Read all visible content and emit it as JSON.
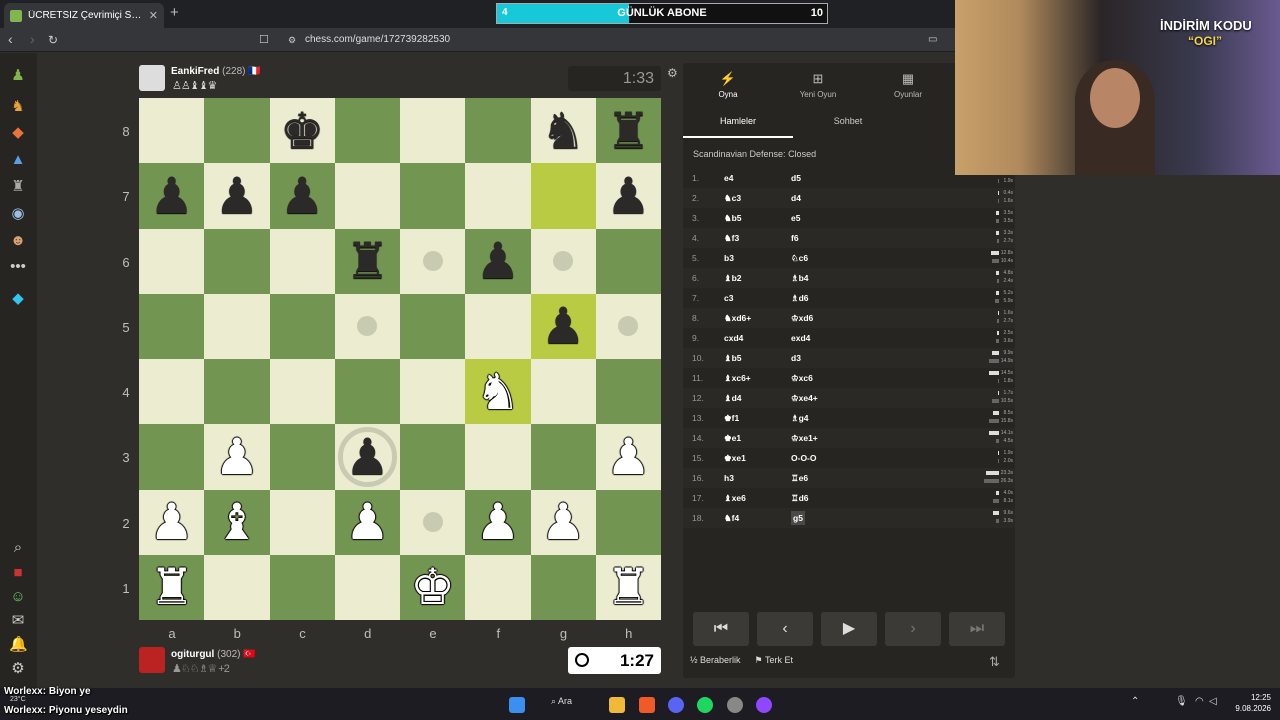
{
  "browser": {
    "tab_title": "ÜCRETSİZ Çevrimiçi Satranç Oyna",
    "new_tab": "+",
    "url": "chess.com/game/172739282530"
  },
  "sub_goal": {
    "current": "4",
    "label": "GÜNLÜK ABONE",
    "target": "10",
    "progress": 0.4
  },
  "promo": {
    "line1": "İNDİRİM KODU",
    "line2": "“OGI”"
  },
  "opponent": {
    "name": "EankiFred",
    "rating": "(228)",
    "flag": "🇫🇷",
    "captured": "♙♙♝♝♛",
    "clock": "1:33"
  },
  "player": {
    "name": "ogiturgul",
    "rating": "(302)",
    "flag": "🇹🇷",
    "captured": "♟♘♘♗♕",
    "extra": "+2",
    "clock": "1:27"
  },
  "board": {
    "files": [
      "a",
      "b",
      "c",
      "d",
      "e",
      "f",
      "g",
      "h"
    ],
    "ranks": [
      "8",
      "7",
      "6",
      "5",
      "4",
      "3",
      "2",
      "1"
    ],
    "rows": [
      [
        null,
        null,
        "bk",
        null,
        null,
        null,
        "bn",
        "br"
      ],
      [
        "bp",
        "bp",
        "bp",
        null,
        null,
        null,
        null,
        "bp"
      ],
      [
        null,
        null,
        null,
        "br",
        "hint",
        "bp",
        "hint",
        null
      ],
      [
        null,
        null,
        null,
        "hint",
        null,
        null,
        "bp",
        "hint"
      ],
      [
        null,
        null,
        null,
        null,
        null,
        "wn",
        null,
        null
      ],
      [
        null,
        "wp",
        null,
        "bp-cap",
        null,
        null,
        null,
        "wp"
      ],
      [
        "wp",
        "wb",
        null,
        "wp",
        "hint",
        "wp",
        "wp",
        null
      ],
      [
        "wr",
        null,
        null,
        null,
        "wk",
        null,
        null,
        "wr"
      ]
    ],
    "highlights": [
      "g7",
      "g5",
      "f4"
    ]
  },
  "panel": {
    "tabs": [
      {
        "icon": "⚡",
        "label": "Oyna"
      },
      {
        "icon": "⊞",
        "label": "Yeni Oyun"
      },
      {
        "icon": "▦",
        "label": "Oyunlar"
      }
    ],
    "subtabs": [
      "Hamleler",
      "Sohbet"
    ],
    "opening": "Scandinavian Defense: Closed",
    "moves": [
      {
        "n": "1.",
        "w": "e4",
        "b": "d5",
        "tw": "",
        "tb": "1.9s",
        "ww": 0,
        "bw": 2
      },
      {
        "n": "2.",
        "w": "♞c3",
        "b": "d4",
        "tw": "0.4s",
        "tb": "1.6s",
        "ww": 1,
        "bw": 2
      },
      {
        "n": "3.",
        "w": "♞b5",
        "b": "e5",
        "tw": "3.5s",
        "tb": "3.5s",
        "ww": 4,
        "bw": 4
      },
      {
        "n": "4.",
        "w": "♞f3",
        "b": "f6",
        "tw": "3.3s",
        "tb": "2.7s",
        "ww": 4,
        "bw": 3
      },
      {
        "n": "5.",
        "w": "b3",
        "b": "♘c6",
        "tw": "12.8s",
        "tb": "10.4s",
        "ww": 12,
        "bw": 10
      },
      {
        "n": "6.",
        "w": "♝b2",
        "b": "♗b4",
        "tw": "4.8s",
        "tb": "2.4s",
        "ww": 5,
        "bw": 3
      },
      {
        "n": "7.",
        "w": "c3",
        "b": "♗d6",
        "tw": "5.2s",
        "tb": "5.9s",
        "ww": 5,
        "bw": 6
      },
      {
        "n": "8.",
        "w": "♞xd6+",
        "b": "♔xd6",
        "tw": "1.6s",
        "tb": "2.7s",
        "ww": 2,
        "bw": 3
      },
      {
        "n": "9.",
        "w": "cxd4",
        "b": "exd4",
        "tw": "2.5s",
        "tb": "3.6s",
        "ww": 3,
        "bw": 4
      },
      {
        "n": "10.",
        "w": "♝b5",
        "b": "d3",
        "tw": "9.9s",
        "tb": "14.9s",
        "ww": 10,
        "bw": 14
      },
      {
        "n": "11.",
        "w": "♝xc6+",
        "b": "♔xc6",
        "tw": "14.5s",
        "tb": "1.8s",
        "ww": 14,
        "bw": 2
      },
      {
        "n": "12.",
        "w": "♝d4",
        "b": "♔xe4+",
        "tw": "1.7s",
        "tb": "10.5s",
        "ww": 2,
        "bw": 10
      },
      {
        "n": "13.",
        "w": "♚f1",
        "b": "♗g4",
        "tw": "8.5s",
        "tb": "15.8s",
        "ww": 8,
        "bw": 15
      },
      {
        "n": "14.",
        "w": "♚e1",
        "b": "♔xe1+",
        "tw": "14.1s",
        "tb": "4.5s",
        "ww": 14,
        "bw": 5
      },
      {
        "n": "15.",
        "w": "♚xe1",
        "b": "O-O-O",
        "tw": "1.9s",
        "tb": "2.0s",
        "ww": 2,
        "bw": 2
      },
      {
        "n": "16.",
        "w": "h3",
        "b": "♖e6",
        "tw": "23.3s",
        "tb": "26.3s",
        "ww": 18,
        "bw": 22
      },
      {
        "n": "17.",
        "w": "♝xe6",
        "b": "♖d6",
        "tw": "4.0s",
        "tb": "8.1s",
        "ww": 4,
        "bw": 8
      },
      {
        "n": "18.",
        "w": "♞f4",
        "b": "g5",
        "tw": "9.6s",
        "tb": "3.9s",
        "ww": 9,
        "bw": 4
      }
    ],
    "draw_label": "½ Beraberlik",
    "resign_label": "Terk Et"
  },
  "chat": [
    {
      "user": "Worlexx",
      "text": ": Biyon ye"
    },
    {
      "user": "Worlexx",
      "text": ": Piyonu yeseydin"
    }
  ],
  "taskbar": {
    "search": "Ara",
    "weather": "23°C",
    "time": "12:25",
    "date": "9.08.2026"
  }
}
